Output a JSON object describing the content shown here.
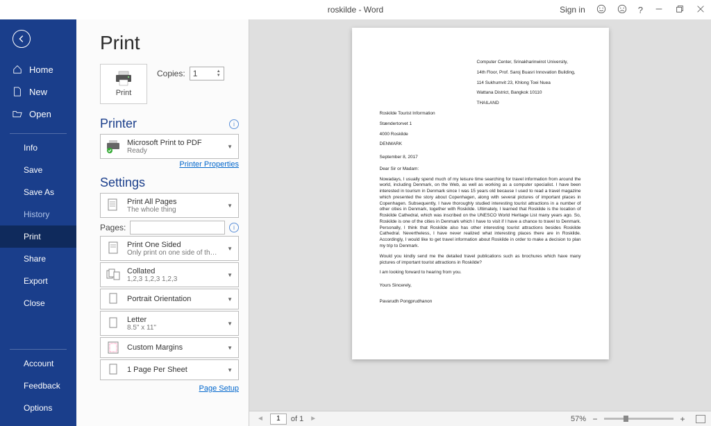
{
  "titlebar": {
    "doc_title": "roskilde  -  Word",
    "signin": "Sign in"
  },
  "sidebar": {
    "home": "Home",
    "new": "New",
    "open": "Open",
    "info": "Info",
    "save": "Save",
    "saveas": "Save As",
    "history": "History",
    "print": "Print",
    "share": "Share",
    "export": "Export",
    "close": "Close",
    "account": "Account",
    "feedback": "Feedback",
    "options": "Options"
  },
  "panel": {
    "heading": "Print",
    "print_btn": "Print",
    "copies_label": "Copies:",
    "copies_value": "1",
    "printer_heading": "Printer",
    "printer_name": "Microsoft Print to PDF",
    "printer_status": "Ready",
    "printer_properties": "Printer Properties",
    "settings_heading": "Settings",
    "print_all_t1": "Print All Pages",
    "print_all_t2": "The whole thing",
    "pages_label": "Pages:",
    "one_sided_t1": "Print One Sided",
    "one_sided_t2": "Only print on one side of th…",
    "collated_t1": "Collated",
    "collated_t2": "1,2,3    1,2,3    1,2,3",
    "portrait_t1": "Portrait Orientation",
    "letter_t1": "Letter",
    "letter_t2": "8.5\" x 11\"",
    "margins_t1": "Custom Margins",
    "pps_t1": "1 Page Per Sheet",
    "page_setup": "Page Setup"
  },
  "document": {
    "sender_l1": "Computer Center, Srinakharinwirot University,",
    "sender_l2": "14th Floor, Prof. Saroj Buasri Innovation Building,",
    "sender_l3": "114 Sukhumvit 23, Khlong Toei Nuea",
    "sender_l4": "Wattana District, Bangkok 10110",
    "sender_l5": "THAILAND",
    "recip_l1": "Roskilde Tourist Information",
    "recip_l2": "Stændertorvet 1",
    "recip_l3": "4000 Roskilde",
    "recip_l4": "DENMARK",
    "date": "September 8, 2017",
    "salutation": "Dear Sir or Madam:",
    "body1": "Nowadays, I usually spend much of my leisure time searching for travel information from around the world, including Denmark, on the Web, as well as working as a computer specialist. I have been interested in tourism in Denmark since I was 15 years old because I used to read a travel magazine which presented the story about Copenhagen, along with several pictures of important places in Copenhagen. Subsequently, I have thoroughly studied interesting tourist attractions in a number of other cities in Denmark, together with Roskilde. Ultimately, I learned that Roskilde is the location of Roskilde Cathedral, which was inscribed on the UNESCO World Heritage List many years ago. So, Roskilde is one of the cities in Denmark which I have to visit if I have a chance to travel to Denmark. Personally, I think that Roskilde also has other interesting tourist attractions besides Roskilde Cathedral. Nevertheless, I have never realized what interesting places there are in Roskilde. Accordingly, I would like to get travel information about Roskilde in order to make a decision to plan my trip to Denmark.",
    "body2": "Would you kindly send me the detailed travel publications such as brochures which have many pictures of important tourist attractions in Roskilde?",
    "body3": "I am looking forward to hearing from you.",
    "closing": "Yours Sincerely,",
    "signature": "Pavarudh Pongprudhanon"
  },
  "footer": {
    "page_current": "1",
    "page_of": "of 1",
    "zoom": "57%"
  }
}
